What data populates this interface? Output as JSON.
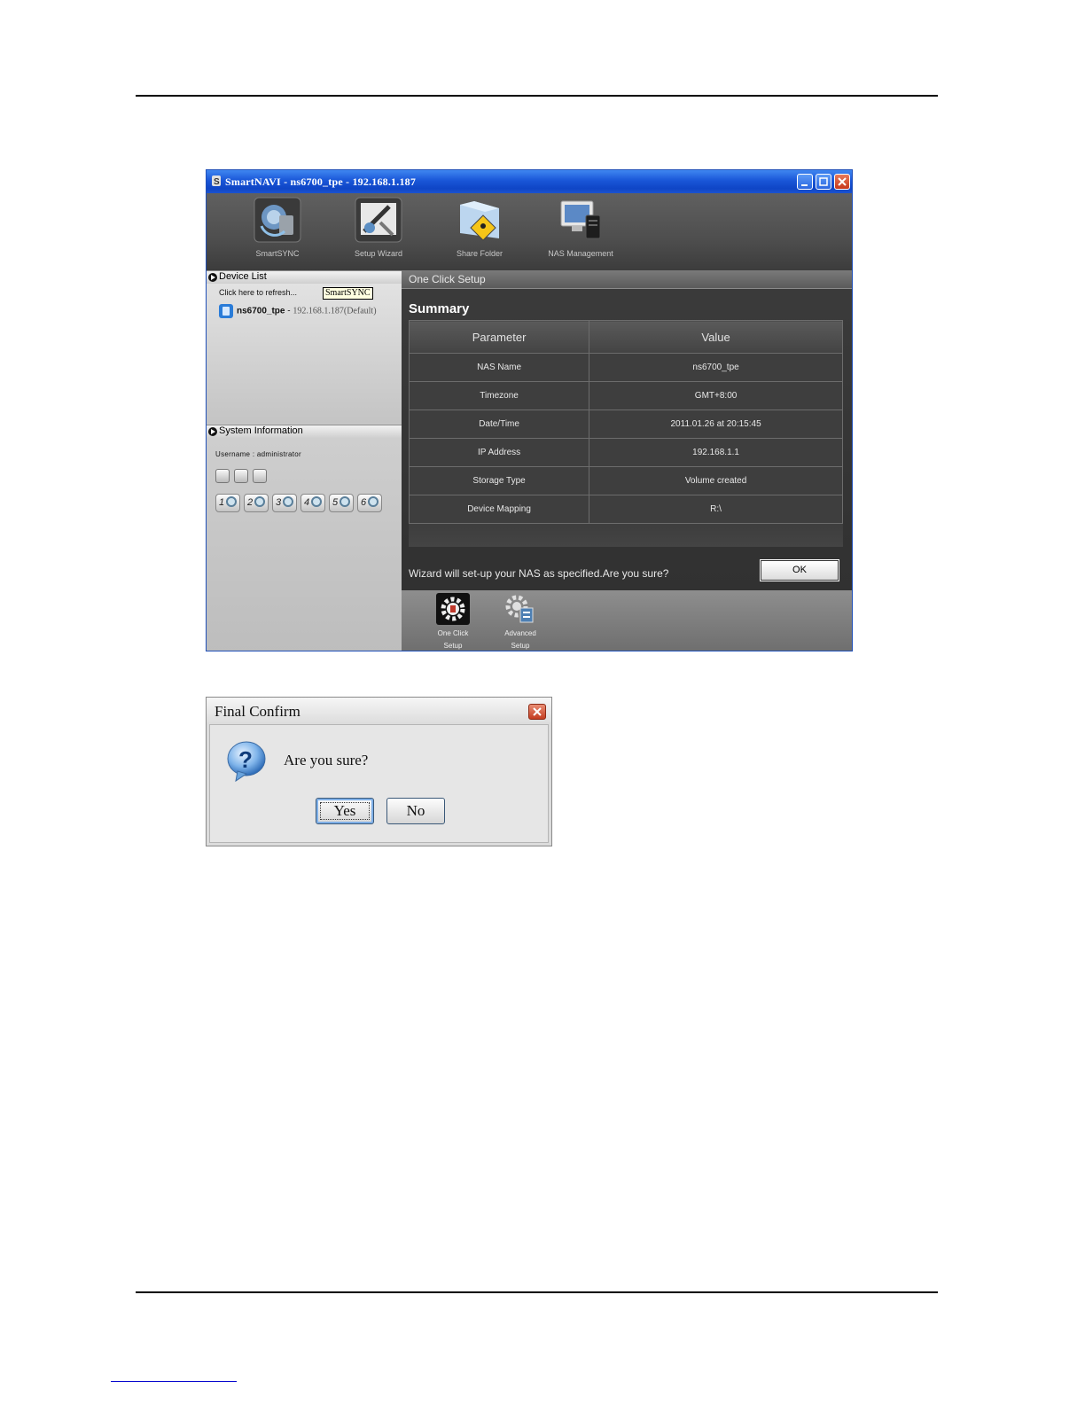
{
  "window": {
    "title": "SmartNAVI - ns6700_tpe - 192.168.1.187"
  },
  "toolbar": {
    "items": [
      {
        "label": "SmartSYNC",
        "icon": "smartsync-icon"
      },
      {
        "label": "Setup Wizard",
        "icon": "setup-wizard-icon"
      },
      {
        "label": "Share Folder",
        "icon": "share-folder-icon"
      },
      {
        "label": "NAS Management",
        "icon": "nas-management-icon"
      }
    ]
  },
  "device_list": {
    "header": "Device List",
    "refresh": "Click here to refresh...",
    "tooltip": "SmartSYNC",
    "device": {
      "name": "ns6700_tpe",
      "sep": " - ",
      "ip": "192.168.1.187(Default)"
    }
  },
  "system_info": {
    "header": "System Information",
    "username": "Username : administrator",
    "disks": [
      "1",
      "2",
      "3",
      "4",
      "5",
      "6"
    ]
  },
  "main": {
    "header": "One Click Setup",
    "summary_title": "Summary",
    "columns": [
      "Parameter",
      "Value"
    ],
    "rows": [
      {
        "param": "NAS Name",
        "value": "ns6700_tpe"
      },
      {
        "param": "Timezone",
        "value": "GMT+8:00"
      },
      {
        "param": "Date/Time",
        "value": "2011.01.26 at 20:15:45"
      },
      {
        "param": "IP Address",
        "value": "192.168.1.1"
      },
      {
        "param": "Storage Type",
        "value": "Volume created"
      },
      {
        "param": "Device Mapping",
        "value": "R:\\"
      }
    ],
    "confirm_message": "Wizard will set-up your NAS as specified.Are you sure?",
    "ok_label": "OK"
  },
  "bottom_tools": [
    {
      "line1": "One Click",
      "line2": "Setup"
    },
    {
      "line1": "Advanced",
      "line2": "Setup"
    }
  ],
  "dialog": {
    "title": "Final Confirm",
    "message": "Are you sure?",
    "yes_label": "Yes",
    "no_label": "No"
  },
  "colors": {
    "titlebar_blue": "#1956d8",
    "panel_dark": "#3b3b3b",
    "close_red": "#c7381a"
  }
}
